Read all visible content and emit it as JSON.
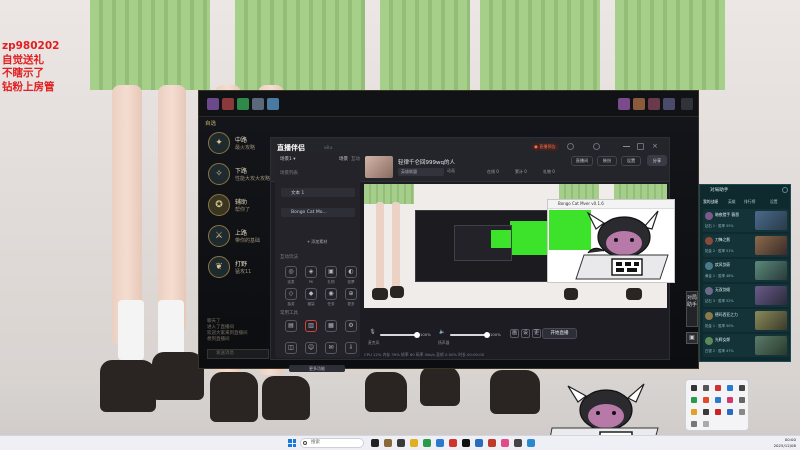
{
  "overlay_lines": [
    "zp980202",
    "自觉送礼",
    "不瞎示了",
    "钻粉上房管"
  ],
  "game": {
    "roles_header": "自选",
    "roles": [
      {
        "name": "中路",
        "sub": "最火攻略"
      },
      {
        "name": "下路",
        "sub": "性能大攻大攻略"
      },
      {
        "name": "辅助",
        "sub": "帮你了"
      },
      {
        "name": "上路",
        "sub": "带你的基础"
      },
      {
        "name": "打野",
        "sub": "猛攻11"
      }
    ],
    "chat_log": [
      "聊天了",
      "进入了直播间",
      "欢迎大家来到直播间",
      "想到直播间"
    ],
    "chat_placeholder": "发送消息",
    "side_tab": "对局助手"
  },
  "companion": {
    "brand": "直播伴侣",
    "version": "v8.x",
    "scene_header": "场景1 ▾",
    "scene_tabs": [
      "场景",
      "互动"
    ],
    "scene_list_label": "场景列表",
    "scene_items": [
      "文本 1",
      "Bongo Cat Mo..."
    ],
    "add_source": "+ 添加素材",
    "interact_label": "互动玩法",
    "interact_tiles": [
      "连麦",
      "PK",
      "礼物",
      "投票",
      "抽奖",
      "福袋",
      "任务",
      "更多"
    ],
    "tools_label": "常用工具",
    "tool_tiles": [
      "剪辑",
      "数据",
      "直播间",
      "设置",
      "贴纸",
      "美颜",
      "弹幕",
      "下载"
    ],
    "more_label": "更多功能",
    "room_title": "轻律千仑回999wq的人",
    "room_category": "英雄联盟",
    "room_animation": "动画",
    "stats": [
      "在线 0",
      "累计 0",
      "礼物 0"
    ],
    "live_badge": "● 直播预告",
    "top_buttons": [
      "直播间",
      "装扮",
      "设置"
    ],
    "share": "分享",
    "mic_label": "麦克风",
    "mic_value": "100%",
    "speaker_label": "扬声器",
    "speaker_value": "100%",
    "ctrl_buttons": [
      "画",
      "设",
      "更"
    ],
    "go_live": "开始直播",
    "status_text": "CPU 12%   内存 39%   帧率 60   码率 0kb/s   丢帧 0.00%   时长 00:00:00"
  },
  "bongo": {
    "title": "Bongo Cat Mver v0.1.6"
  },
  "chatpanel": {
    "title": "对局助手",
    "tabs": [
      "我的战绩",
      "英雄",
      "排行榜",
      "设置"
    ],
    "items": [
      {
        "name": "暗夜猎手 薇恩",
        "rank": "钻石 1 · 胜率 55%"
      },
      {
        "name": "刀锋之影",
        "rank": "铂金 2 · 胜率 51%"
      },
      {
        "name": "疾风剑豪",
        "rank": "黄金 1 · 胜率 48%"
      },
      {
        "name": "无双剑姬",
        "rank": "钻石 3 · 胜率 52%"
      },
      {
        "name": "德玛西亚之力",
        "rank": "铂金 1 · 胜率 50%"
      },
      {
        "name": "光辉女郎",
        "rank": "白银 2 · 胜率 47%"
      }
    ]
  },
  "taskbar": {
    "search_placeholder": "搜索",
    "time": "00:00",
    "date": "2025/12/08"
  },
  "colors": {
    "overlay_red": "#e11f1f",
    "game_gold": "#c8aa6e",
    "chroma_green": "#3de32a",
    "panel_teal": "#0f2a2f"
  }
}
